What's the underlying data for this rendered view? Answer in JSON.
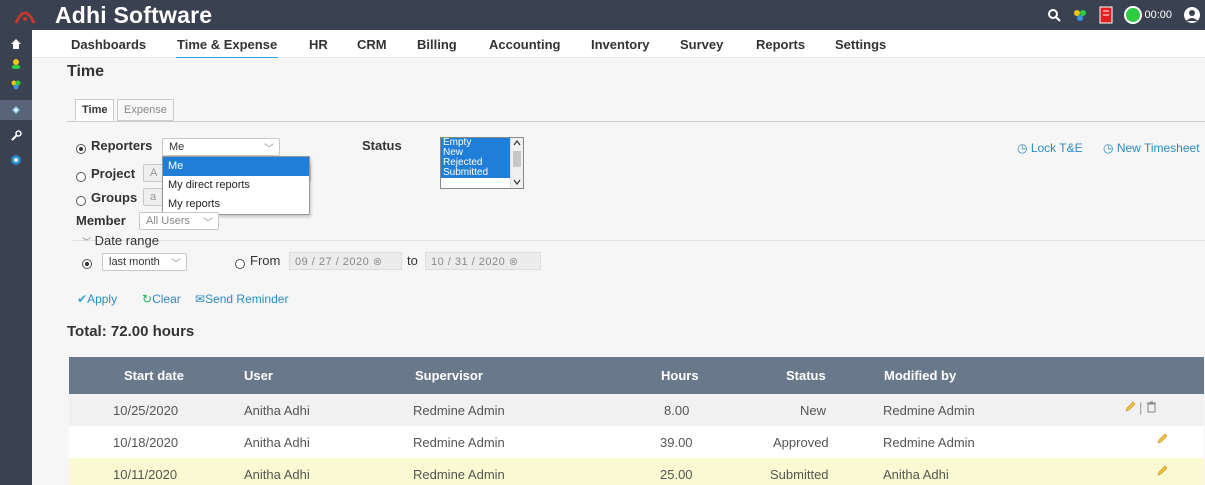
{
  "app": {
    "title": "Adhi Software",
    "timer": "00:00"
  },
  "menu": [
    "Dashboards",
    "Time & Expense",
    "HR",
    "CRM",
    "Billing",
    "Accounting",
    "Inventory",
    "Survey",
    "Reports",
    "Settings"
  ],
  "menu_active": "Time & Expense",
  "page": {
    "title": "Time"
  },
  "tabs": [
    {
      "label": "Time",
      "active": true
    },
    {
      "label": "Expense",
      "active": false
    }
  ],
  "filters": {
    "reporters_label": "Reporters",
    "reporters_value": "Me",
    "reporters_options": [
      "Me",
      "My direct reports",
      "My reports"
    ],
    "project_label": "Project",
    "project_value": "A",
    "groups_label": "Groups",
    "groups_value": "a",
    "status_label": "Status",
    "status_options": [
      "Empty",
      "New",
      "Rejected",
      "Submitted"
    ],
    "member_label": "Member",
    "member_value": "All Users",
    "date_range_label": "Date range",
    "period_value": "last month",
    "from_label": "From",
    "from_date": "09 / 27 / 2020",
    "to_label": "to",
    "to_date": "10 / 31 / 2020"
  },
  "actions": {
    "apply": "Apply",
    "clear": "Clear",
    "send_reminder": "Send Reminder"
  },
  "right_links": {
    "lock": "Lock T&E",
    "new_timesheet": "New Timesheet"
  },
  "total": "Total: 72.00 hours",
  "table": {
    "headers": [
      "Start date",
      "User",
      "Supervisor",
      "Hours",
      "Status",
      "Modified by"
    ],
    "rows": [
      {
        "start": "10/25/2020",
        "user": "Anitha Adhi",
        "supervisor": "Redmine Admin",
        "hours": "8.00",
        "status": "New",
        "modified": "Redmine Admin"
      },
      {
        "start": "10/18/2020",
        "user": "Anitha Adhi",
        "supervisor": "Redmine Admin",
        "hours": "39.00",
        "status": "Approved",
        "modified": "Redmine Admin"
      },
      {
        "start": "10/11/2020",
        "user": "Anitha Adhi",
        "supervisor": "Redmine Admin",
        "hours": "25.00",
        "status": "Submitted",
        "modified": "Anitha Adhi"
      }
    ]
  },
  "colors": {
    "topbar": "#3a4150",
    "accent": "#2ea4d8",
    "table_header": "#6a788c",
    "link": "#2b8cc4",
    "select_highlight": "#1e7ed8"
  }
}
